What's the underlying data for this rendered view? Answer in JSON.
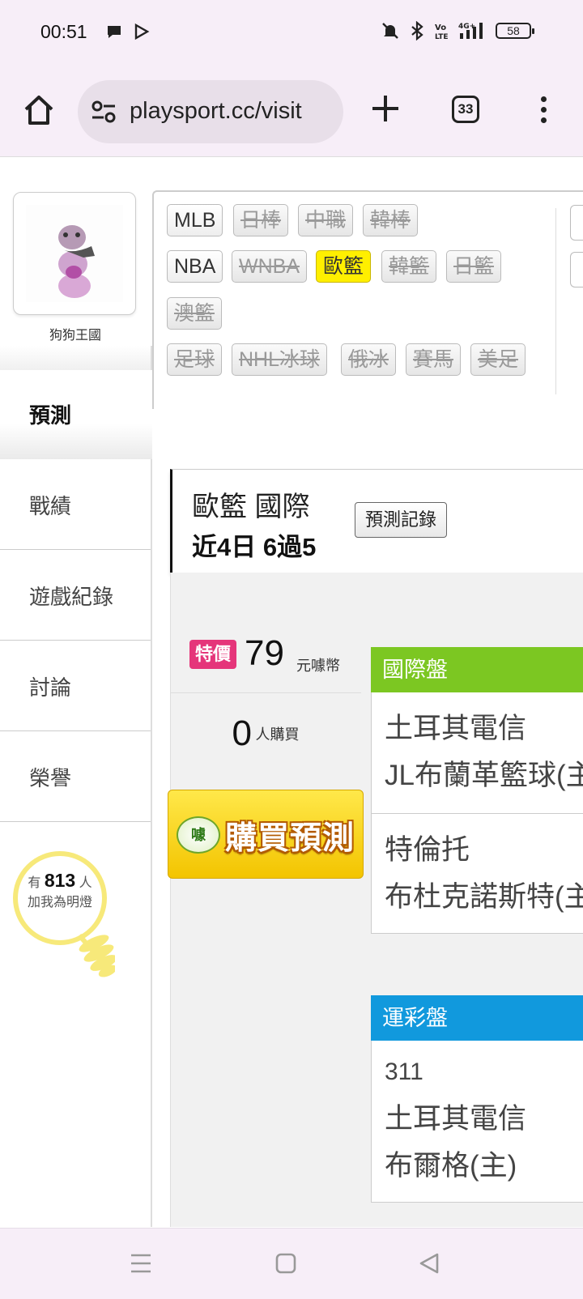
{
  "status_bar": {
    "time": "00:51",
    "battery": "58"
  },
  "browser": {
    "url": "playsport.cc/visit",
    "tab_count": "33"
  },
  "profile": {
    "name": "狗狗王國"
  },
  "left_nav": {
    "active": "預測",
    "items": [
      "戰績",
      "遊戲紀錄",
      "討論",
      "榮譽"
    ]
  },
  "fans": {
    "prefix": "有",
    "count": "813",
    "suffix": "人",
    "caption": "加我為明燈"
  },
  "sport_tabs": {
    "row1": [
      {
        "label": "MLB",
        "state": "on"
      },
      {
        "label": "日棒",
        "state": "off"
      },
      {
        "label": "中職",
        "state": "off"
      },
      {
        "label": "韓棒",
        "state": "off"
      }
    ],
    "row2": [
      {
        "label": "NBA",
        "state": "on"
      },
      {
        "label": "WNBA",
        "state": "off"
      },
      {
        "label": "歐籃",
        "state": "selected"
      },
      {
        "label": "韓籃",
        "state": "off"
      },
      {
        "label": "日籃",
        "state": "off"
      }
    ],
    "row3": [
      {
        "label": "澳籃",
        "state": "off"
      }
    ],
    "row4": [
      {
        "label": "足球",
        "state": "off"
      },
      {
        "label": "NHL冰球",
        "state": "off"
      },
      {
        "label": "俄冰",
        "state": "off"
      },
      {
        "label": "賽馬",
        "state": "off"
      },
      {
        "label": "美足",
        "state": "off"
      }
    ]
  },
  "record": {
    "title": "歐籃 國際",
    "summary": "近4日 6過5",
    "history_button": "預測記錄"
  },
  "purchase": {
    "special_tag": "特價",
    "price": "79",
    "price_unit": "元噱幣",
    "buyers": "0",
    "buyers_unit": "人購買",
    "buy_button": "購買預測",
    "logo_text": "噱"
  },
  "international": {
    "header": "國際盤",
    "matches": [
      {
        "line1": "土耳其電信",
        "line2": "JL布蘭革籃球(主)"
      },
      {
        "line1": "特倫托",
        "line2": "布杜克諾斯特(主)"
      }
    ]
  },
  "lottery": {
    "header": "運彩盤",
    "matches": [
      {
        "code": "311",
        "line1": "土耳其電信",
        "line2": "布爾格(主)"
      }
    ]
  },
  "colors": {
    "accent_yellow": "#ffef00",
    "special_pink": "#e5357a",
    "intl_green": "#7cc722",
    "lottery_blue": "#1199dd"
  }
}
